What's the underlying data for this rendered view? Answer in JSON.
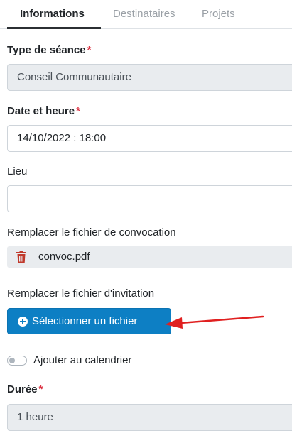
{
  "tabs": [
    {
      "label": "Informations",
      "active": true
    },
    {
      "label": "Destinataires",
      "active": false
    },
    {
      "label": "Projets",
      "active": false
    }
  ],
  "form": {
    "type_seance": {
      "label": "Type de séance",
      "required_mark": "*",
      "value": "Conseil Communautaire"
    },
    "date_heure": {
      "label": "Date et heure",
      "required_mark": "*",
      "value": "14/10/2022 : 18:00"
    },
    "lieu": {
      "label": "Lieu",
      "value": ""
    },
    "convocation": {
      "label": "Remplacer le fichier de convocation",
      "file_name": "convoc.pdf",
      "icon": "trash-icon"
    },
    "invitation": {
      "label": "Remplacer le fichier d'invitation",
      "button_label": "Sélectionner un fichier",
      "button_icon": "plus-circle-icon"
    },
    "calendrier": {
      "label": "Ajouter au calendrier",
      "checked": false
    },
    "duree": {
      "label": "Durée",
      "required_mark": "*",
      "value": "1 heure"
    }
  },
  "colors": {
    "primary": "#0d7fc4",
    "required": "#dc3545",
    "trash": "#c0392b",
    "arrow": "#e02020",
    "disabled_bg": "#e9ecef"
  }
}
